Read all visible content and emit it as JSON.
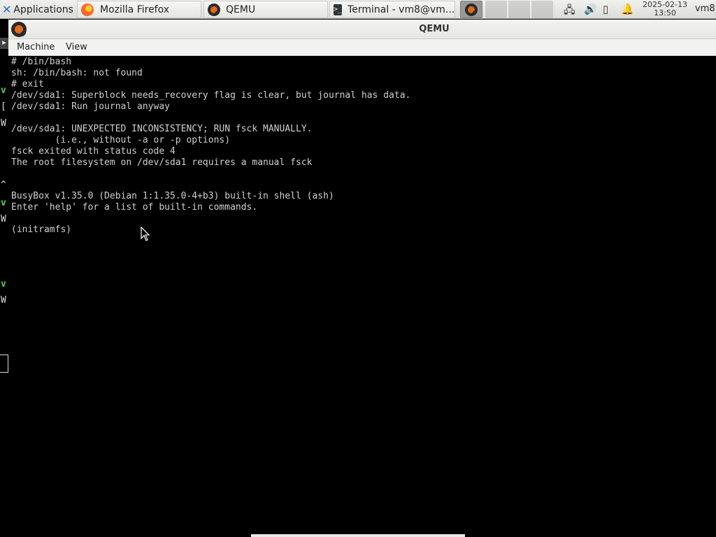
{
  "panel": {
    "app_menu": "Applications",
    "tasks": [
      {
        "label": "Mozilla Firefox"
      },
      {
        "label": "QEMU"
      },
      {
        "label": "Terminal - vm8@vm..."
      }
    ],
    "clock": {
      "date": "2025-02-13",
      "time": "13:50"
    },
    "user": "vm8"
  },
  "background_terminal": {
    "glyphs": [
      "v",
      "[",
      "W",
      "^",
      "v",
      "W",
      "v",
      "W"
    ]
  },
  "qemu": {
    "title": "QEMU",
    "menu": [
      "Machine",
      "View"
    ],
    "console_lines": [
      "# /bin/bash",
      "sh: /bin/bash: not found",
      "# exit",
      "/dev/sda1: Superblock needs_recovery flag is clear, but journal has data.",
      "/dev/sda1: Run journal anyway",
      "",
      "/dev/sda1: UNEXPECTED INCONSISTENCY; RUN fsck MANUALLY.",
      "        (i.e., without -a or -p options)",
      "fsck exited with status code 4",
      "The root filesystem on /dev/sda1 requires a manual fsck",
      "",
      "",
      "BusyBox v1.35.0 (Debian 1:1.35.0-4+b3) built-in shell (ash)",
      "Enter 'help' for a list of built-in commands.",
      "",
      "(initramfs)"
    ]
  },
  "icons": [
    "xfce-logo-icon",
    "firefox-icon",
    "qemu-icon",
    "terminal-icon",
    "network-icon",
    "volume-icon",
    "battery-icon",
    "notification-bell-icon",
    "mouse-cursor-icon"
  ]
}
